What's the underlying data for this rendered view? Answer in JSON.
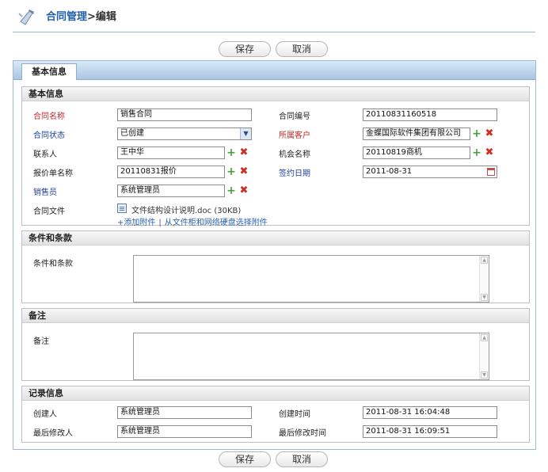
{
  "header": {
    "crumb_link": "合同管理",
    "crumb_sep": ">",
    "crumb_current": "编辑"
  },
  "toolbar": {
    "save_label": "保存",
    "cancel_label": "取消"
  },
  "tab": {
    "label": "基本信息"
  },
  "basic": {
    "title": "基本信息",
    "contract_name_label": "合同名称",
    "contract_name_value": "销售合同",
    "contract_no_label": "合同编号",
    "contract_no_value": "20110831160518",
    "status_label": "合同状态",
    "status_value": "已创建",
    "customer_label": "所属客户",
    "customer_value": "金蝶国际软件集团有限公司",
    "contact_label": "联系人",
    "contact_value": "王中华",
    "opportunity_label": "机会名称",
    "opportunity_value": "20110819商机",
    "quote_label": "报价单名称",
    "quote_value": "20110831报价",
    "sign_date_label": "签约日期",
    "sign_date_value": "2011-08-31",
    "salesman_label": "销售员",
    "salesman_value": "系统管理员",
    "file_label": "合同文件",
    "file_name": "文件结构设计说明.doc (30KB)",
    "add_attachment": "+添加附件",
    "attach_sep": "|",
    "select_attachment": "从文件柜和网络硬盘选择附件"
  },
  "terms": {
    "title": "条件和条款",
    "field_label": "条件和条款"
  },
  "remark": {
    "title": "备注",
    "field_label": "备注"
  },
  "record": {
    "title": "记录信息",
    "creator_label": "创建人",
    "creator_value": "系统管理员",
    "created_label": "创建时间",
    "created_value": "2011-08-31 16:04:48",
    "modifier_label": "最后修改人",
    "modifier_value": "系统管理员",
    "modified_label": "最后修改时间",
    "modified_value": "2011-08-31 16:09:51"
  },
  "icons": {
    "plus": "plus-icon",
    "delete": "delete-icon",
    "calendar": "calendar-icon",
    "doc": "document-icon",
    "select": "chevron-down-icon"
  },
  "colors": {
    "required_label": "#c0282a",
    "lookup_label": "#1f3f9a",
    "link": "#2a63b0",
    "tab_bar": "#a9c6e4"
  }
}
